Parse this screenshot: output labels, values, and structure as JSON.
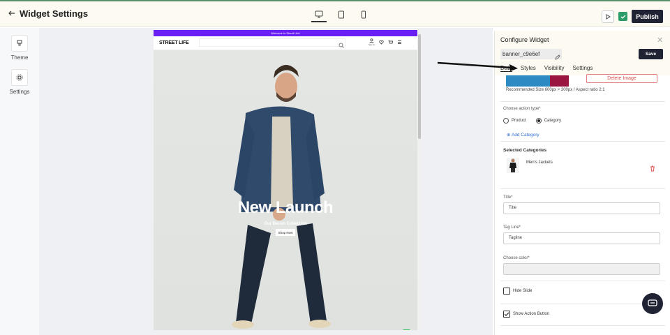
{
  "header": {
    "back_icon": "arrow-left-icon",
    "title": "Widget Settings",
    "devices": [
      "desktop-icon",
      "tablet-icon",
      "mobile-icon"
    ],
    "publish_label": "Publish"
  },
  "leftbar": {
    "items": [
      {
        "label": "Theme",
        "icon": "palette-icon"
      },
      {
        "label": "Settings",
        "icon": "gear-icon"
      }
    ]
  },
  "preview": {
    "announcement": "Welcome to Street Life!",
    "store_name": "STREET LIFE",
    "signin_label": "Sign In",
    "hero": {
      "title": "New Launch",
      "tagline": "Our Denim Collection",
      "button": "Shop Now"
    }
  },
  "config": {
    "title": "Configure Widget",
    "widget_name": "banner_c9e6ef",
    "save_label": "Save",
    "tabs": [
      "Data",
      "Styles",
      "Visibility",
      "Settings"
    ],
    "active_tab": "Data",
    "delete_image_label": "Delete Image",
    "recommended": "Recommended Size 600px × 300px / Aspect ratio 2:1",
    "action_type_label": "Choose action type*",
    "action_options": [
      "Product",
      "Category"
    ],
    "action_selected": "Category",
    "add_category_label": "Add Category",
    "selected_categories_label": "Selected Categories",
    "categories": [
      {
        "name": "Men's Jackets"
      }
    ],
    "title_label": "Title*",
    "title_placeholder": "Title",
    "tagline_label": "Tag Line*",
    "tagline_placeholder": "Tagline",
    "color_label": "Choose color*",
    "hide_slide_label": "Hide Slide",
    "hide_slide_checked": false,
    "show_action_label": "Show Action Button",
    "show_action_checked": true
  },
  "colors": {
    "announcement_bar": "#6a1ff5",
    "publish_button": "#1f2333",
    "delete_red": "#e04d4d",
    "link_blue": "#2f6fd1",
    "check_green": "#2e9b6a"
  }
}
